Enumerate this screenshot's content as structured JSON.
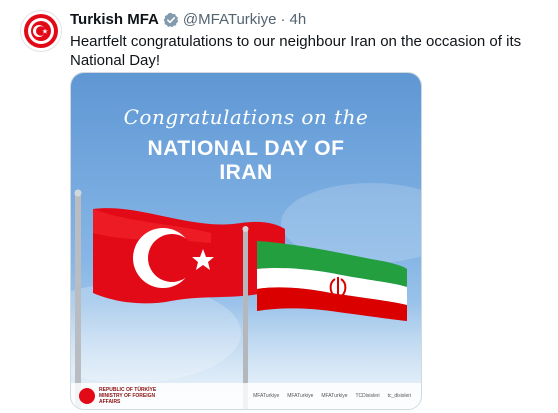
{
  "tweet": {
    "display_name": "Turkish MFA",
    "handle": "@MFATurkiye",
    "separator": "·",
    "time": "4h",
    "text": "Heartfelt congratulations to our neighbour Iran on the occasion of its National Day!",
    "verified": true
  },
  "media": {
    "line1": "Congratulations on the",
    "line2": "NATIONAL DAY OF",
    "line3": "IRAN",
    "footer_ministry_line1": "REPUBLIC OF TÜRKİYE",
    "footer_ministry_line2": "MINISTRY OF FOREIGN AFFAIRS",
    "footer_socials": [
      "MFATurkiye",
      "MFATurkiye",
      "MFATurkiye",
      "TCDisisleri",
      "tc_disisleri"
    ]
  },
  "colors": {
    "sky": "#6fa2d8",
    "turkey_red": "#e30a17",
    "iran_green": "#239f40",
    "iran_red": "#da0000",
    "verified_gray": "#829aab"
  }
}
